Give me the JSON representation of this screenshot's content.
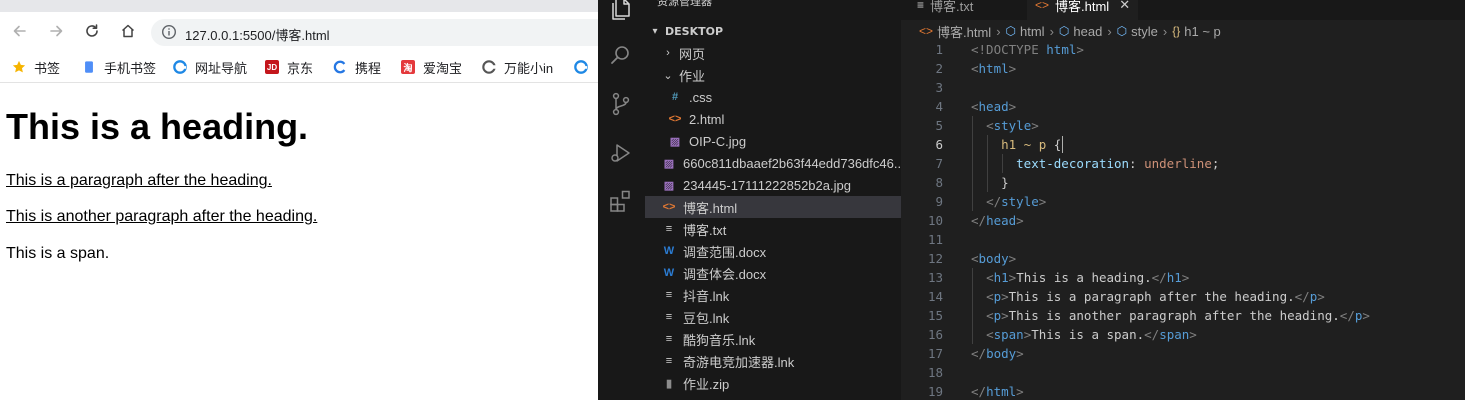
{
  "browser": {
    "url": "127.0.0.1:5500/博客.html",
    "bookmarks": [
      {
        "label": "书签",
        "icon": "star-icon",
        "color": "#f6b400"
      },
      {
        "label": "手机书签",
        "icon": "phone-bookmark-icon",
        "color": "#4f8ef7"
      },
      {
        "label": "网址导航",
        "icon": "edge-icon",
        "color": "#1e88e5"
      },
      {
        "label": "京东",
        "icon": "jd-icon",
        "color": "#c4161c"
      },
      {
        "label": "携程",
        "icon": "ctrip-icon",
        "color": "#2577e3"
      },
      {
        "label": "爱淘宝",
        "icon": "taobao-icon",
        "color": "#e4393c"
      },
      {
        "label": "万能小in",
        "icon": "in-icon",
        "color": "#555555"
      },
      {
        "label": "",
        "icon": "edge-icon",
        "color": "#1e88e5"
      }
    ],
    "page": {
      "heading": "This is a heading.",
      "p1": "This is a paragraph after the heading.",
      "p2": "This is another paragraph after the heading.",
      "span": "This is a span."
    }
  },
  "vscode": {
    "sidebar_title": "资源管理器",
    "sidebar_more": "···",
    "section": "DESKTOP",
    "tree": [
      {
        "label": "网页",
        "type": "folder-closed",
        "depth": 1
      },
      {
        "label": "作业",
        "type": "folder-open",
        "depth": 1
      },
      {
        "label": ".css",
        "type": "css",
        "depth": 2
      },
      {
        "label": "2.html",
        "type": "html",
        "depth": 2
      },
      {
        "label": "OIP-C.jpg",
        "type": "image",
        "depth": 2
      },
      {
        "label": "660c811dbaaef2b63f44edd736dfc46...",
        "type": "image",
        "depth": 1
      },
      {
        "label": "234445-17111222852b2a.jpg",
        "type": "image",
        "depth": 1
      },
      {
        "label": "博客.html",
        "type": "html",
        "depth": 1,
        "selected": true
      },
      {
        "label": "博客.txt",
        "type": "text",
        "depth": 1
      },
      {
        "label": "调查范围.docx",
        "type": "word",
        "depth": 1
      },
      {
        "label": "调查体会.docx",
        "type": "word",
        "depth": 1
      },
      {
        "label": "抖音.lnk",
        "type": "text",
        "depth": 1
      },
      {
        "label": "豆包.lnk",
        "type": "text",
        "depth": 1
      },
      {
        "label": "酷狗音乐.lnk",
        "type": "text",
        "depth": 1
      },
      {
        "label": "奇游电竞加速器.lnk",
        "type": "text",
        "depth": 1
      },
      {
        "label": "作业.zip",
        "type": "zip",
        "depth": 1
      }
    ],
    "tabs": [
      {
        "label": "博客.txt",
        "active": false
      },
      {
        "label": "博客.html",
        "active": true
      }
    ],
    "tab_close": "✕",
    "breadcrumbs": [
      {
        "label": "博客.html",
        "icon": "html-icon"
      },
      {
        "label": "html",
        "icon": "tag-icon"
      },
      {
        "label": "head",
        "icon": "tag-icon"
      },
      {
        "label": "style",
        "icon": "tag-icon"
      },
      {
        "label": "h1 ~ p",
        "icon": "selector-icon"
      }
    ],
    "active_line": 6,
    "code": [
      [
        [
          "t-gray",
          "<!DOCTYPE "
        ],
        [
          "t-tag",
          "html"
        ],
        [
          "t-gray",
          ">"
        ]
      ],
      [
        [
          "t-gray",
          "<"
        ],
        [
          "t-tag",
          "html"
        ],
        [
          "t-gray",
          ">"
        ]
      ],
      [],
      [
        [
          "t-gray",
          "<"
        ],
        [
          "t-tag",
          "head"
        ],
        [
          "t-gray",
          ">"
        ]
      ],
      [
        [
          "t-txt",
          "  "
        ],
        [
          "t-gray",
          "<"
        ],
        [
          "t-tag",
          "style"
        ],
        [
          "t-gray",
          ">"
        ]
      ],
      [
        [
          "t-txt",
          "    "
        ],
        [
          "t-sel",
          "h1 ~ p"
        ],
        [
          "t-punc",
          " {"
        ]
      ],
      [
        [
          "t-txt",
          "      "
        ],
        [
          "t-prop",
          "text-decoration"
        ],
        [
          "t-punc",
          ": "
        ],
        [
          "t-val",
          "underline"
        ],
        [
          "t-punc",
          ";"
        ]
      ],
      [
        [
          "t-txt",
          "    "
        ],
        [
          "t-punc",
          "}"
        ]
      ],
      [
        [
          "t-txt",
          "  "
        ],
        [
          "t-gray",
          "</"
        ],
        [
          "t-tag",
          "style"
        ],
        [
          "t-gray",
          ">"
        ]
      ],
      [
        [
          "t-gray",
          "</"
        ],
        [
          "t-tag",
          "head"
        ],
        [
          "t-gray",
          ">"
        ]
      ],
      [],
      [
        [
          "t-gray",
          "<"
        ],
        [
          "t-tag",
          "body"
        ],
        [
          "t-gray",
          ">"
        ]
      ],
      [
        [
          "t-txt",
          "  "
        ],
        [
          "t-gray",
          "<"
        ],
        [
          "t-tag",
          "h1"
        ],
        [
          "t-gray",
          ">"
        ],
        [
          "t-txt",
          "This is a heading."
        ],
        [
          "t-gray",
          "</"
        ],
        [
          "t-tag",
          "h1"
        ],
        [
          "t-gray",
          ">"
        ]
      ],
      [
        [
          "t-txt",
          "  "
        ],
        [
          "t-gray",
          "<"
        ],
        [
          "t-tag",
          "p"
        ],
        [
          "t-gray",
          ">"
        ],
        [
          "t-txt",
          "This is a paragraph after the heading."
        ],
        [
          "t-gray",
          "</"
        ],
        [
          "t-tag",
          "p"
        ],
        [
          "t-gray",
          ">"
        ]
      ],
      [
        [
          "t-txt",
          "  "
        ],
        [
          "t-gray",
          "<"
        ],
        [
          "t-tag",
          "p"
        ],
        [
          "t-gray",
          ">"
        ],
        [
          "t-txt",
          "This is another paragraph after the heading."
        ],
        [
          "t-gray",
          "</"
        ],
        [
          "t-tag",
          "p"
        ],
        [
          "t-gray",
          ">"
        ]
      ],
      [
        [
          "t-txt",
          "  "
        ],
        [
          "t-gray",
          "<"
        ],
        [
          "t-tag",
          "span"
        ],
        [
          "t-gray",
          ">"
        ],
        [
          "t-txt",
          "This is a span."
        ],
        [
          "t-gray",
          "</"
        ],
        [
          "t-tag",
          "span"
        ],
        [
          "t-gray",
          ">"
        ]
      ],
      [
        [
          "t-gray",
          "</"
        ],
        [
          "t-tag",
          "body"
        ],
        [
          "t-gray",
          ">"
        ]
      ],
      [],
      [
        [
          "t-gray",
          "</"
        ],
        [
          "t-tag",
          "html"
        ],
        [
          "t-gray",
          ">"
        ]
      ]
    ]
  }
}
